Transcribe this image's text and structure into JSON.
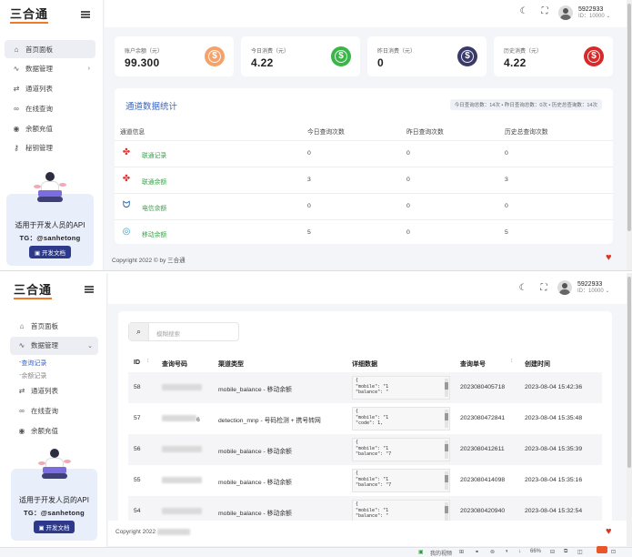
{
  "brand": {
    "logo_text": "三合通",
    "accent": "#f07a2a"
  },
  "user": {
    "name": "5922933",
    "id": "ID：10000"
  },
  "top": {
    "sidebar": {
      "items": [
        {
          "label": "首页面板",
          "icon": "home-icon",
          "active": true
        },
        {
          "label": "数据管理",
          "icon": "activity-icon",
          "arrow": "›"
        },
        {
          "label": "通道列表",
          "icon": "swap-icon"
        },
        {
          "label": "在线查询",
          "icon": "link-icon"
        },
        {
          "label": "余额充值",
          "icon": "circle-dot-icon"
        },
        {
          "label": "秘钥管理",
          "icon": "key-icon"
        }
      ]
    },
    "promo": {
      "title": "适用于开发人员的API",
      "tg": "TG：@sanhetong",
      "button": "开发文档"
    },
    "stats": [
      {
        "label": "账户余额（元）",
        "value": "99.300",
        "color": "#f4a26a"
      },
      {
        "label": "今日消费（元）",
        "value": "4.22",
        "color": "#3ab548"
      },
      {
        "label": "昨日消费（元）",
        "value": "0",
        "color": "#3a3a6a"
      },
      {
        "label": "历史消费（元）",
        "value": "4.22",
        "color": "#d62a2a"
      }
    ],
    "channel": {
      "title": "通道数据统计",
      "summary": "今日查询总数：14次 • 昨日查询总数：0次 • 历史总查询数：14次",
      "headers": [
        "通道信息",
        "今日查询次数",
        "昨日查询次数",
        "历史总查询次数"
      ],
      "rows": [
        {
          "name": "联通记录",
          "icon": "unicom-icon",
          "today": "0",
          "yesterday": "0",
          "total": "0"
        },
        {
          "name": "联通余额",
          "icon": "unicom-icon",
          "today": "3",
          "yesterday": "0",
          "total": "3"
        },
        {
          "name": "电信余额",
          "icon": "telecom-icon",
          "today": "0",
          "yesterday": "0",
          "total": "0"
        },
        {
          "name": "移动余额",
          "icon": "mobile-icon",
          "today": "5",
          "yesterday": "0",
          "total": "5"
        }
      ]
    },
    "footer": "Copyright 2022 © by 三合通"
  },
  "bottom": {
    "sidebar": {
      "items": [
        {
          "label": "首页面板",
          "icon": "home-icon"
        },
        {
          "label": "数据管理",
          "icon": "activity-icon",
          "active": true,
          "arrow": "⌄"
        }
      ],
      "subs": [
        {
          "label": "查询记录",
          "selected": true
        },
        {
          "label": "余额记录"
        }
      ],
      "items2": [
        {
          "label": "通道列表",
          "icon": "swap-icon"
        },
        {
          "label": "在线查询",
          "icon": "link-icon"
        },
        {
          "label": "余额充值",
          "icon": "circle-dot-icon"
        }
      ]
    },
    "search": {
      "placeholder": "模糊搜索"
    },
    "table": {
      "headers": [
        "ID",
        "查询号码",
        "渠道类型",
        "详细数据",
        "查询单号",
        "创建时间"
      ],
      "sort_icon": "↕",
      "rows": [
        {
          "id": "58",
          "phone_visible": "",
          "channel": "mobile_balance - 移动余额",
          "code_l1": "{",
          "code_l2": "  \"mobile\": \"1",
          "code_l3": "  \"balance\": \"",
          "order": "2023080405718",
          "time": "2023-08-04 15:42:36"
        },
        {
          "id": "57",
          "phone_visible": "6",
          "channel": "detection_mnp - 号码检测 + 携号转网",
          "code_l1": "{",
          "code_l2": "  \"mobile\": \"1",
          "code_l3": "  \"code\": 1,",
          "order": "2023080472841",
          "time": "2023-08-04 15:35:48"
        },
        {
          "id": "56",
          "phone_visible": "",
          "channel": "mobile_balance - 移动余额",
          "code_l1": "{",
          "code_l2": "  \"mobile\": \"1",
          "code_l3": "  \"balance\": \"7",
          "order": "2023080412611",
          "time": "2023-08-04 15:35:39"
        },
        {
          "id": "55",
          "phone_visible": "",
          "channel": "mobile_balance - 移动余额",
          "code_l1": "{",
          "code_l2": "  \"mobile\": \"1",
          "code_l3": "  \"balance\": \"7",
          "order": "2023080414098",
          "time": "2023-08-04 15:35:16"
        },
        {
          "id": "54",
          "phone_visible": "",
          "channel": "mobile_balance - 移动余额",
          "code_l1": "{",
          "code_l2": "  \"mobile\": \"1",
          "code_l3": "  \"balance\": \"",
          "order": "2023080420940",
          "time": "2023-08-04 15:32:54"
        }
      ]
    },
    "footer": "Copyright 2022",
    "status": {
      "label": "我的视频",
      "zoom": "66%"
    }
  }
}
